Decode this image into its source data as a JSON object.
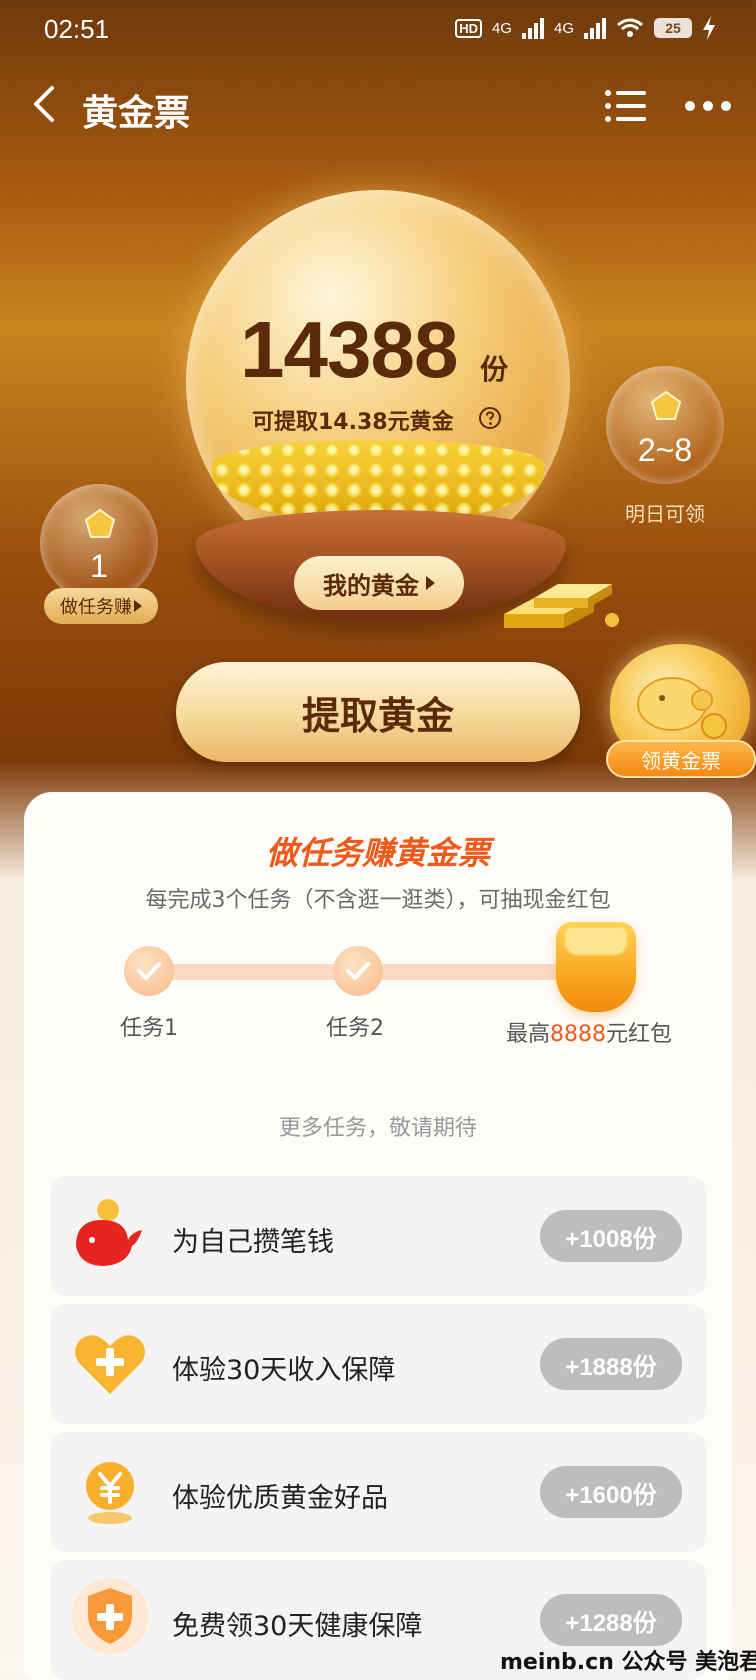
{
  "status_bar": {
    "time": "02:51",
    "hd": "HD",
    "net1": "4G",
    "net2": "4G",
    "battery": "25"
  },
  "header": {
    "title": "黄金票"
  },
  "globe": {
    "gold_count": "14388",
    "unit": "份",
    "withdrawable_text": "可提取14.38元黄金",
    "my_gold_button": "我的黄金"
  },
  "side_left": {
    "count": "1",
    "tag_label": "做任务赚"
  },
  "side_right": {
    "range": "2~8",
    "label": "明日可领"
  },
  "withdraw_button": "提取黄金",
  "reward_button": "领黄金票",
  "tasks_card": {
    "title": "做任务赚黄金票",
    "subtitle": "每完成3个任务（不含逛一逛类），可抽现金红包",
    "steps": [
      {
        "label": "任务1"
      },
      {
        "label": "任务2"
      },
      {
        "label_prefix": "最高",
        "label_highlight": "8888",
        "label_suffix": "元红包"
      }
    ],
    "more_tasks_text": "更多任务，敬请期待",
    "items": [
      {
        "name": "为自己攒笔钱",
        "reward": "+1008份",
        "icon": "whale-icon"
      },
      {
        "name": "体验30天收入保障",
        "reward": "+1888份",
        "icon": "heart-plus-icon"
      },
      {
        "name": "体验优质黄金好品",
        "reward": "+1600份",
        "icon": "yuan-coin-icon"
      },
      {
        "name": "免费领30天健康保障",
        "reward": "+1288份",
        "icon": "shield-plus-icon"
      }
    ]
  },
  "watermark": "meinb.cn  公众号 美泡君",
  "colors": {
    "accent": "#ef5a1c",
    "gold_text": "#5a2a0a",
    "reward_disabled": "#bdbdbd"
  }
}
